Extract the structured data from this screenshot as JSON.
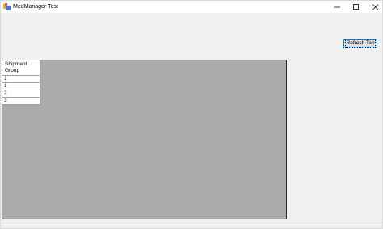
{
  "window": {
    "title": "MedManager Test",
    "icon": "app-icon"
  },
  "toolbar": {
    "refresh_label": "Refresh Tab"
  },
  "grid": {
    "columns": [
      "Shipment Group"
    ],
    "rows": [
      "1",
      "1",
      "2",
      "3"
    ]
  },
  "colors": {
    "grid_background": "#ababab",
    "window_background": "#f0f0f0",
    "button_border": "#0078d7"
  }
}
